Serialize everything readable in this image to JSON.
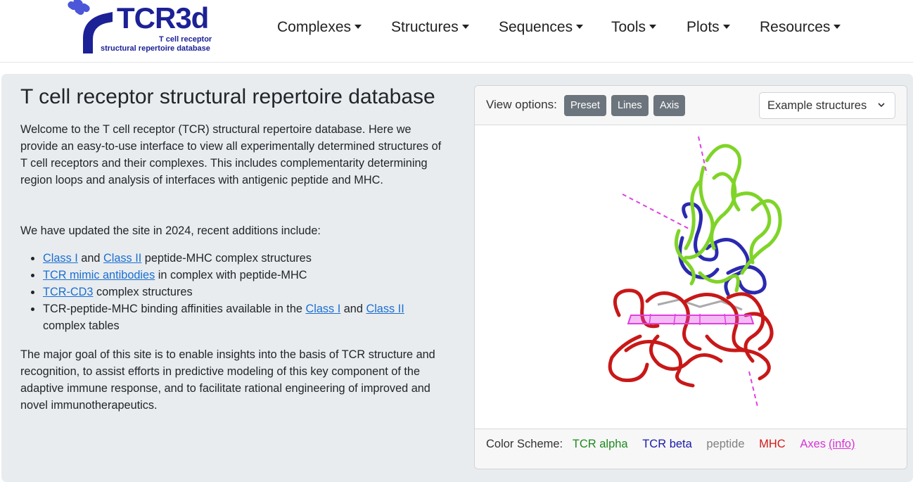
{
  "logo": {
    "title": "TCR3d",
    "subtitle_line1": "T cell receptor",
    "subtitle_line2": "structural repertoire database"
  },
  "nav": [
    {
      "label": "Complexes"
    },
    {
      "label": "Structures"
    },
    {
      "label": "Sequences"
    },
    {
      "label": "Tools"
    },
    {
      "label": "Plots"
    },
    {
      "label": "Resources"
    }
  ],
  "main": {
    "title": "T cell receptor structural repertoire database",
    "intro": "Welcome to the T cell receptor (TCR) structural repertoire database. Here we provide an easy-to-use interface to view all experimentally determined structures of T cell receptors and their complexes. This includes complementarity determining region loops and analysis of interfaces with antigenic peptide and MHC.",
    "update_text": "We have updated the site in 2024, recent additions include:",
    "bullets": {
      "b1_link1": "Class I",
      "b1_mid": " and ",
      "b1_link2": "Class II",
      "b1_end": " peptide-MHC complex structures",
      "b2_link": "TCR mimic antibodies",
      "b2_end": " in complex with peptide-MHC",
      "b3_link": "TCR-CD3",
      "b3_end": " complex structures",
      "b4_start": "TCR-peptide-MHC binding affinities available in the ",
      "b4_link1": "Class I",
      "b4_mid": " and ",
      "b4_link2": "Class II",
      "b4_end": " complex tables"
    },
    "goal": "The major goal of this site is to enable insights into the basis of TCR structure and recognition, to assist efforts in predictive modeling of this key component of the adaptive immune response, and to facilitate rational engineering of improved and novel immunotherapeutics."
  },
  "viewer": {
    "view_options_label": "View options:",
    "buttons": [
      "Preset",
      "Lines",
      "Axis"
    ],
    "example_select": "Example structures",
    "color_scheme_label": "Color Scheme:",
    "scheme": [
      {
        "label": "TCR alpha",
        "color": "#1e8a1e"
      },
      {
        "label": "TCR beta",
        "color": "#1a1aa8"
      },
      {
        "label": "peptide",
        "color": "#808080"
      },
      {
        "label": "MHC",
        "color": "#d11a1a"
      },
      {
        "label": "Axes",
        "color": "#d633d6"
      }
    ],
    "info_link": "(info)"
  },
  "colors": {
    "brand": "#1c2196",
    "panel_bg": "#e9ecef",
    "button_gray": "#6c757d",
    "link": "#1a6fd1",
    "tcr_alpha_render": "#7fd428",
    "tcr_beta_render": "#2a2ab0",
    "mhc_render": "#c81818",
    "axes_render": "#e040e0"
  }
}
